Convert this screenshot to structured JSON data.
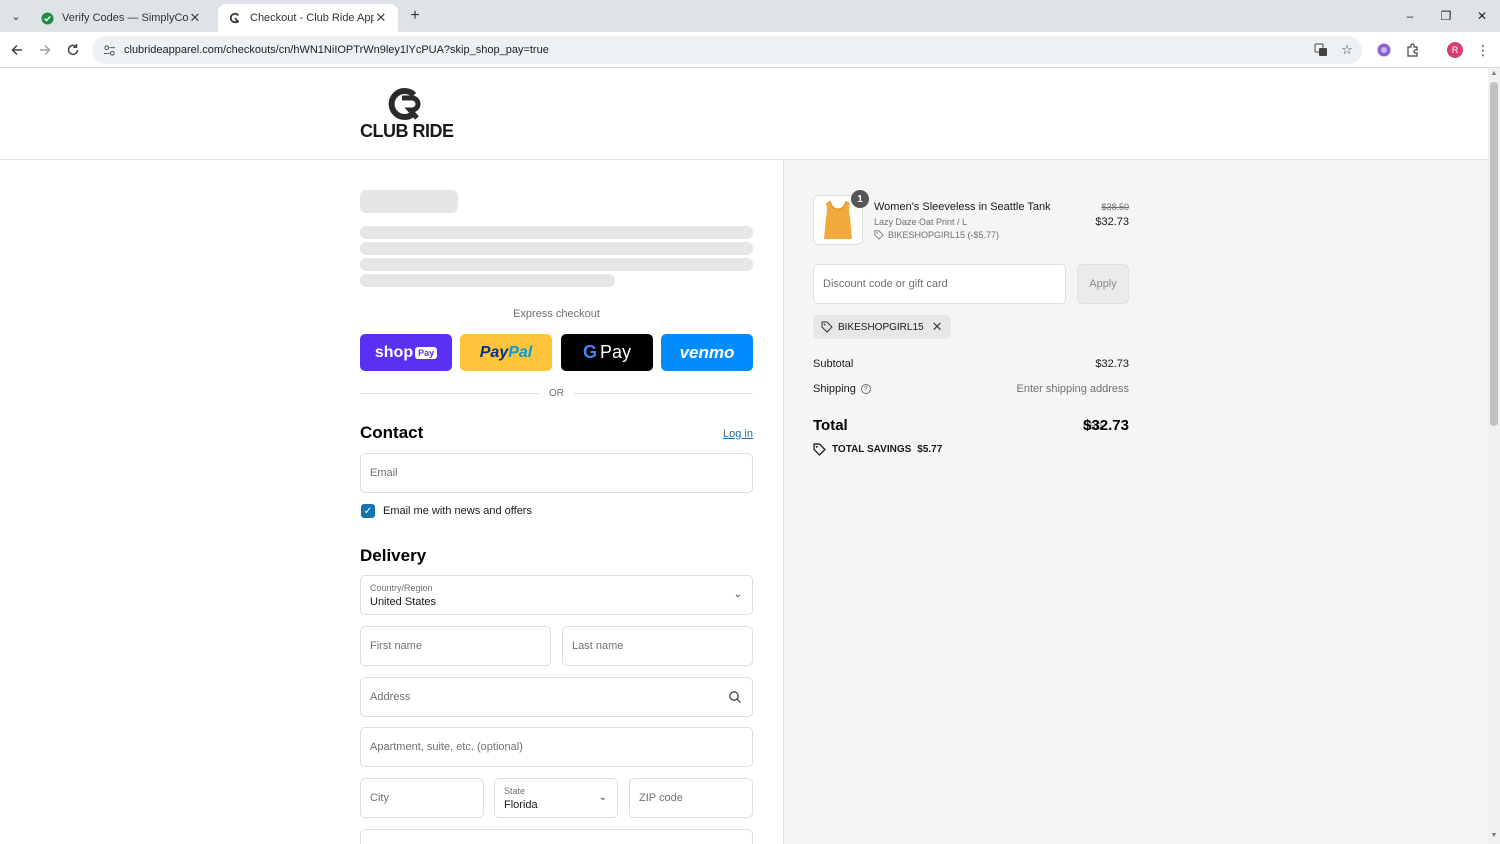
{
  "browser": {
    "tabs": [
      {
        "title": "Verify Codes — SimplyCodes",
        "active": false
      },
      {
        "title": "Checkout - Club Ride Apparel",
        "active": true
      }
    ],
    "url": "clubrideapparel.com/checkouts/cn/hWN1NiIOPTrWn9ley1lYcPUA?skip_shop_pay=true",
    "profile_initial": "R",
    "window_controls": {
      "minimize": "–",
      "restore": "❐",
      "close": "✕"
    }
  },
  "brand": {
    "logo_text": "CLUB RIDE"
  },
  "checkout": {
    "express_label": "Express checkout",
    "buttons": {
      "shop": "shop",
      "shop_tag": "Pay",
      "paypal_1": "Pay",
      "paypal_2": "Pal",
      "gpay_g": "G",
      "gpay_text": "Pay",
      "venmo": "venmo"
    },
    "or_text": "OR",
    "contact": {
      "title": "Contact",
      "login": "Log in",
      "email_placeholder": "Email",
      "news_checkbox": "Email me with news and offers"
    },
    "delivery": {
      "title": "Delivery",
      "country_label": "Country/Region",
      "country_value": "United States",
      "first_name": "First name",
      "last_name": "Last name",
      "address": "Address",
      "apartment": "Apartment, suite, etc. (optional)",
      "city": "City",
      "state_label": "State",
      "state_value": "Florida",
      "zip": "ZIP code"
    }
  },
  "summary": {
    "product": {
      "quantity": "1",
      "name": "Women's Sleeveless in Seattle Tank",
      "variant": "Lazy Daze Oat Print / L",
      "code": "BIKESHOPGIRL15 (-$5.77)",
      "old_price": "$38.50",
      "price": "$32.73"
    },
    "discount_placeholder": "Discount code or gift card",
    "apply_label": "Apply",
    "applied_code": "BIKESHOPGIRL15",
    "subtotal_label": "Subtotal",
    "subtotal_value": "$32.73",
    "shipping_label": "Shipping",
    "shipping_value": "Enter shipping address",
    "total_label": "Total",
    "total_currency": "USD",
    "total_value": "$32.73",
    "savings_label": "TOTAL SAVINGS",
    "savings_value": "$5.77"
  }
}
